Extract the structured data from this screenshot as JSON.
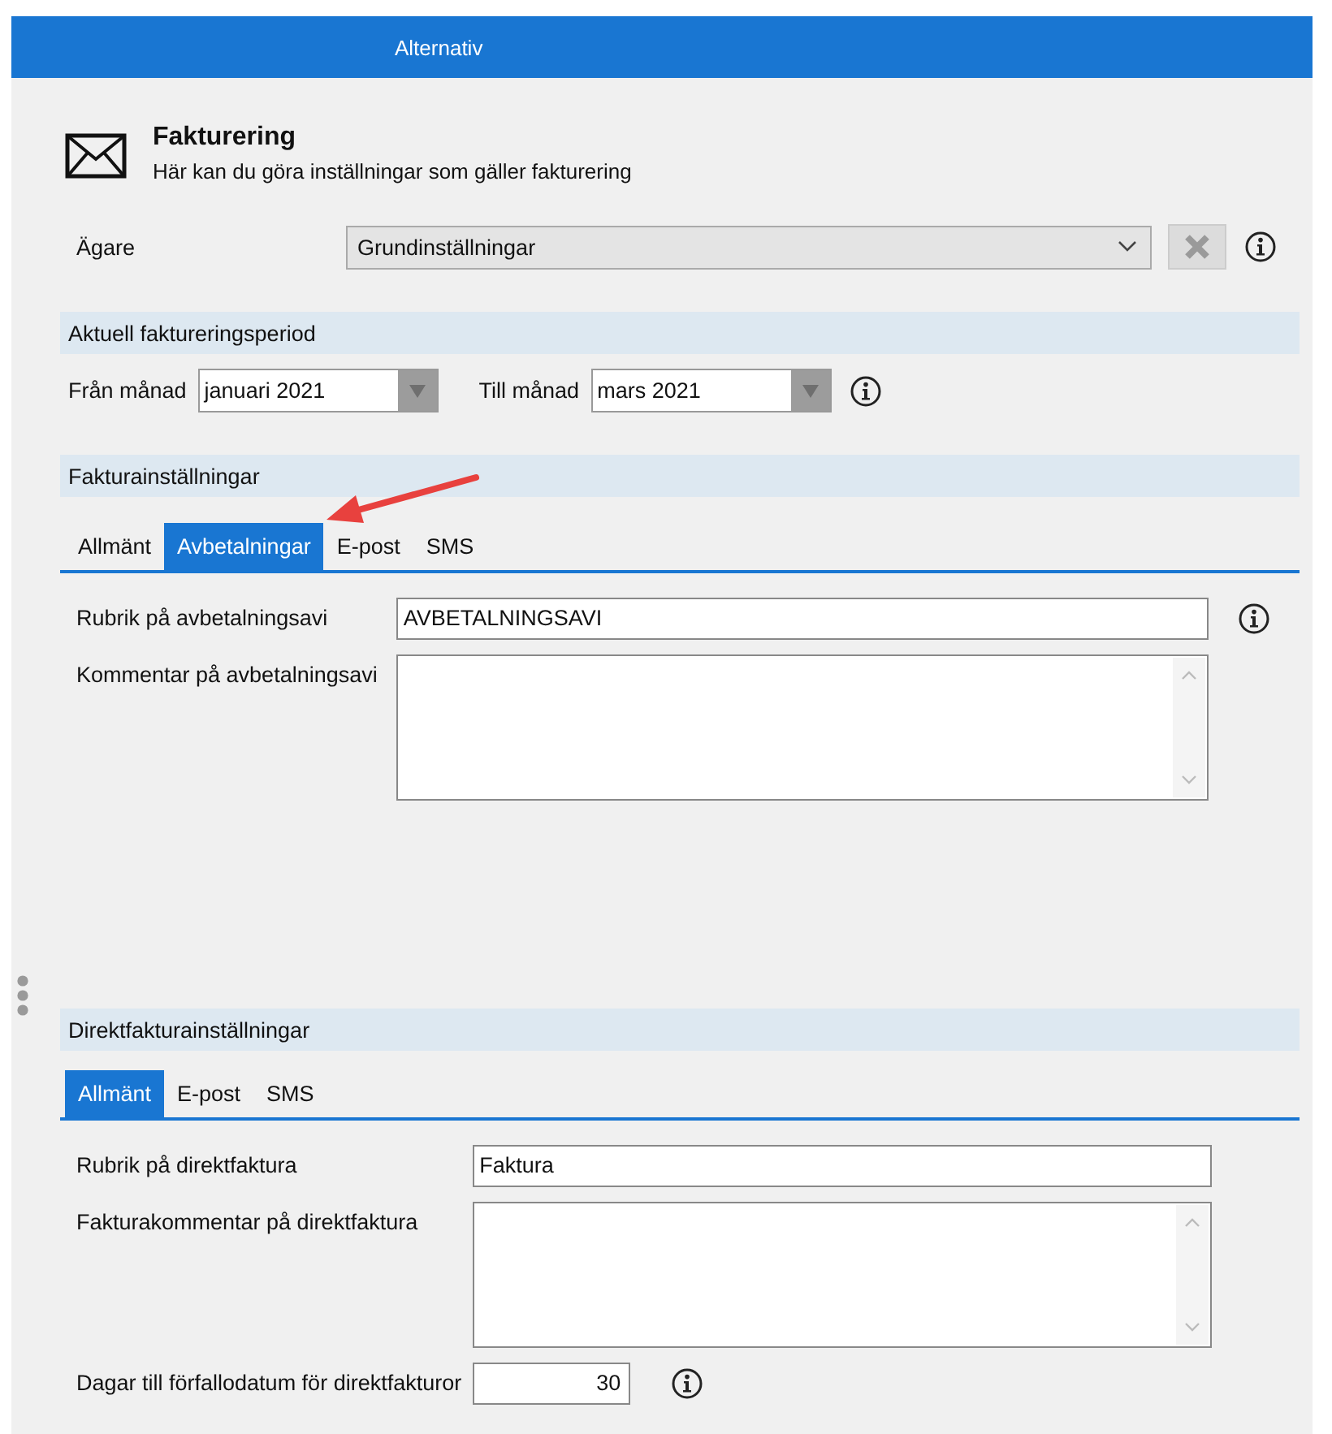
{
  "window": {
    "title": "Alternativ"
  },
  "header": {
    "title": "Fakturering",
    "subtitle": "Här kan du göra inställningar som gäller fakturering"
  },
  "owner": {
    "label": "Ägare",
    "value": "Grundinställningar"
  },
  "period": {
    "heading": "Aktuell faktureringsperiod",
    "from": {
      "label": "Från månad",
      "value": "januari 2021"
    },
    "to": {
      "label": "Till månad",
      "value": "mars 2021"
    }
  },
  "invoice_settings": {
    "heading": "Fakturainställningar",
    "tabs": [
      {
        "label": "Allmänt",
        "selected": false
      },
      {
        "label": "Avbetalningar",
        "selected": true
      },
      {
        "label": "E-post",
        "selected": false
      },
      {
        "label": "SMS",
        "selected": false
      }
    ],
    "fields": [
      {
        "kind": "text",
        "label": "Rubrik på avbetalningsavi",
        "value": "AVBETALNINGSAVI",
        "info": true
      },
      {
        "kind": "textarea",
        "label": "Kommentar på avbetalningsavi",
        "info": false
      }
    ]
  },
  "direct_invoice": {
    "heading": "Direktfakturainställningar",
    "tabs": [
      {
        "label": "Allmänt",
        "selected": true
      },
      {
        "label": "E-post",
        "selected": false
      },
      {
        "label": "SMS",
        "selected": false
      }
    ],
    "fields": [
      {
        "kind": "text",
        "label": "Rubrik på direktfaktura",
        "value": "Faktura",
        "info": false
      },
      {
        "kind": "textarea",
        "label": "Fakturakommentar på direktfaktura",
        "info": false
      },
      {
        "kind": "number",
        "label": "Dagar till förfallodatum för direktfakturor",
        "value": "30",
        "info": true
      }
    ]
  }
}
